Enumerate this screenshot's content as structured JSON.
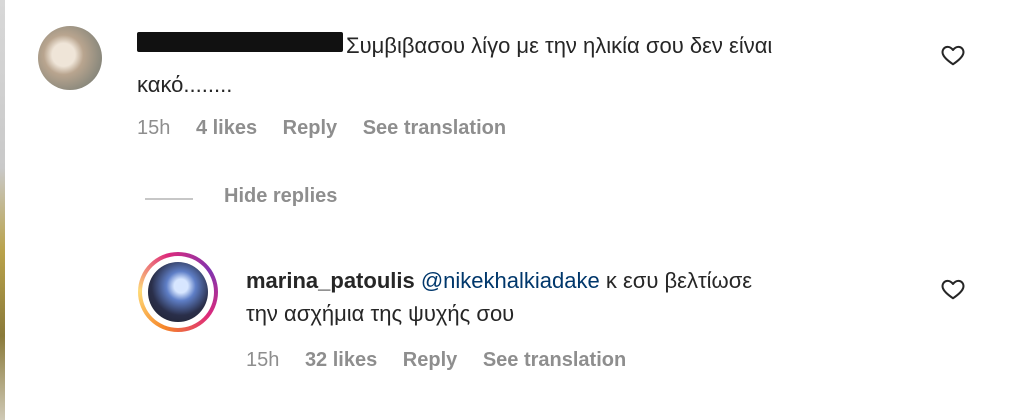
{
  "comments": [
    {
      "username_redacted": true,
      "text_line1": "Συμβιβασου λίγο με την ηλικία σου δεν είναι",
      "text_line2": "κακό........",
      "time": "15h",
      "likes": "4 likes",
      "reply": "Reply",
      "see_translation": "See translation"
    }
  ],
  "replies_toggle": "Hide replies",
  "reply": {
    "username": "marina_patoulis",
    "mention": "@nikekhalkiadake",
    "text_line1_rest": " κ εσυ βελτίωσε",
    "text_line2": "την ασχήμια της ψυχής σου",
    "time": "15h",
    "likes": "32 likes",
    "reply": "Reply",
    "see_translation": "See translation"
  },
  "icons": {
    "like": "heart-outline-icon"
  },
  "colors": {
    "meta_text": "#8e8e8e",
    "mention": "#00376b",
    "text": "#262626"
  }
}
